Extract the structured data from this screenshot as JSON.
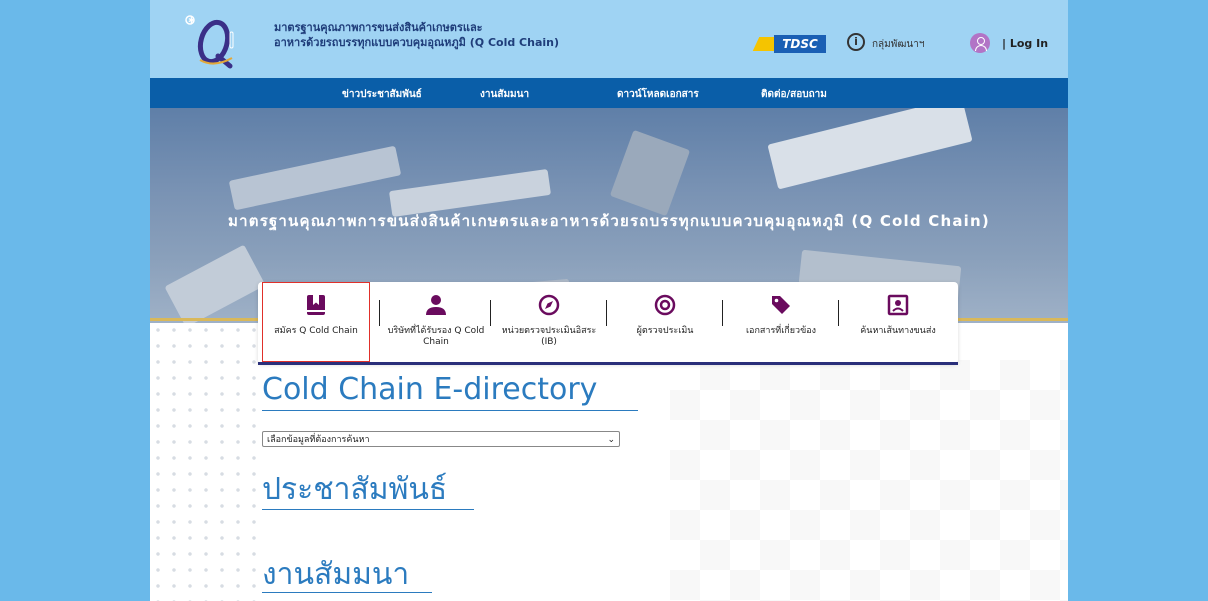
{
  "header": {
    "title_line1": "มาตรฐานคุณภาพการขนส่งสินค้าเกษตรและ",
    "title_line2": "อาหารด้วยรถบรรทุกแบบควบคุมอุณหภูมิ (Q Cold Chain)",
    "tdsc_label": "TDSC",
    "group_label": "กลุ่มพัฒนาฯ",
    "login_label": "| Log In"
  },
  "nav": {
    "items": [
      "ข่าวประชาสัมพันธ์",
      "งานสัมมนา",
      "ดาวน์โหลดเอกสาร",
      "ติดต่อ/สอบถาม"
    ]
  },
  "hero": {
    "title": "มาตรฐานคุณภาพการขนส่งสินค้าเกษตรและอาหารด้วยรถบรรทุกแบบควบคุมอุณหภูมิ (Q Cold Chain)"
  },
  "tabs": [
    {
      "label": "สมัคร Q Cold Chain",
      "icon": "bookmark-book-icon"
    },
    {
      "label": "บริษัทที่ได้รับรอง Q Cold Chain",
      "icon": "person-icon"
    },
    {
      "label": "หน่วยตรวจประเมินอิสระ (IB)",
      "icon": "compass-icon"
    },
    {
      "label": "ผู้ตรวจประเมิน",
      "icon": "target-icon"
    },
    {
      "label": "เอกสารที่เกี่ยวข้อง",
      "icon": "tag-icon"
    },
    {
      "label": "ค้นหาเส้นทางขนส่ง",
      "icon": "map-pin-icon"
    }
  ],
  "content": {
    "edirectory_heading": "Cold Chain E-directory",
    "select_value": "เลือกข้อมูลที่ต้องการค้นหา",
    "pr_heading": "ประชาสัมพันธ์",
    "seminar_heading": "งานสัมมนา"
  },
  "colors": {
    "side": "#6ab9ea",
    "topbar": "#9fd3f3",
    "navbar": "#0a5ea8",
    "heading": "#2b7bbf",
    "icon": "#6a0b5e"
  }
}
